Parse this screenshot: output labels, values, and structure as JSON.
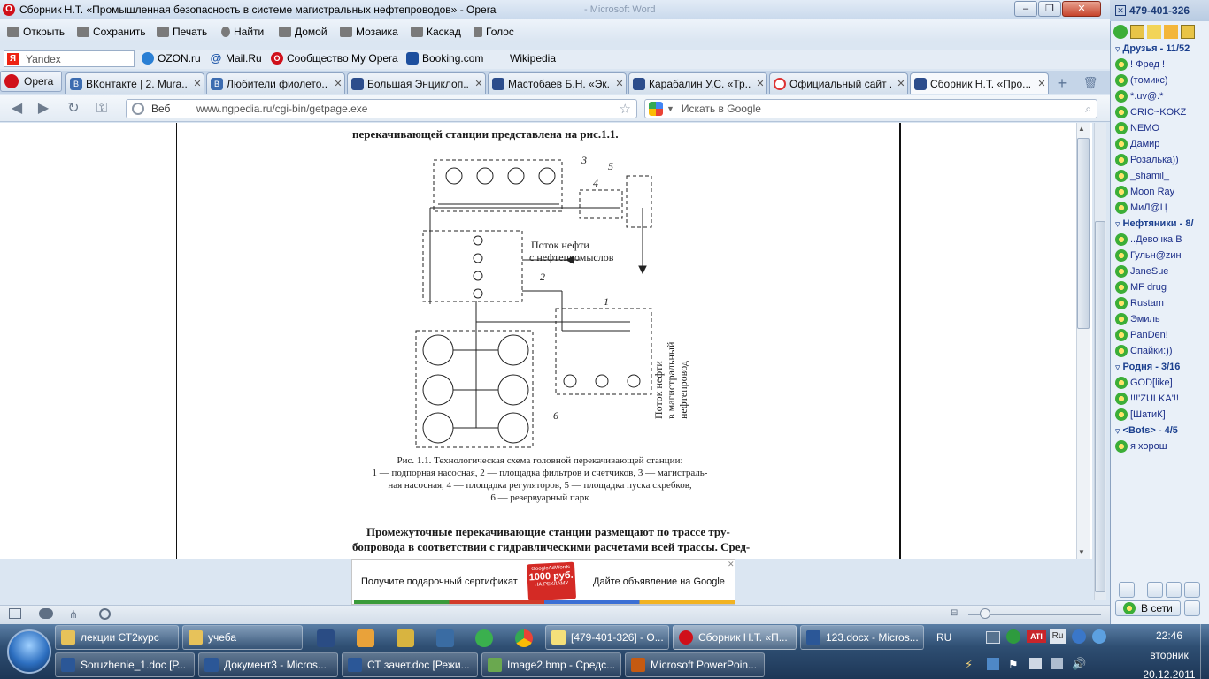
{
  "window": {
    "title": "Сборник Н.Т. «Промышленная безопасность в системе магистральных нефтепроводов» - Opera",
    "ghost_title": "- Microsoft Word"
  },
  "menu": [
    "Открыть",
    "Сохранить",
    "Печать",
    "Найти",
    "Домой",
    "Мозаика",
    "Каскад",
    "Голос"
  ],
  "bookmarks": {
    "yandex": "Yandex",
    "items": [
      "OZON.ru",
      "Mail.Ru",
      "Сообщество My Opera",
      "Booking.com",
      "Wikipedia"
    ]
  },
  "tabs": {
    "opera_button": "Opera",
    "items": [
      {
        "label": "ВКонтакте | 2. Mura...",
        "icon": "vk-icon"
      },
      {
        "label": "Любители фиолето...",
        "icon": "vk-icon"
      },
      {
        "label": "Большая Энциклоп...",
        "icon": "flask-icon"
      },
      {
        "label": "Мастобаев Б.Н. «Эк...",
        "icon": "flask-icon"
      },
      {
        "label": "Карабалин У.С. «Тр...",
        "icon": "flask-icon"
      },
      {
        "label": "Официальный сайт ...",
        "icon": "blocked-icon"
      },
      {
        "label": "Сборник Н.Т. «Про...",
        "icon": "flask-icon"
      }
    ]
  },
  "address": {
    "scope": "Веб",
    "url": "www.ngpedia.ru/cgi-bin/getpage.exe",
    "search_placeholder": "Искать в Google"
  },
  "document": {
    "top_line": "перекачивающей станции представлена на рис.1.1.",
    "diagram_labels": {
      "n1": "1",
      "n2": "2",
      "n3": "3",
      "n4": "4",
      "n5": "5",
      "n6": "6",
      "flow_in_1": "Поток нефти",
      "flow_in_2": "с нефтепромыслов",
      "flow_out_1": "Поток нефти",
      "flow_out_2": "в магистральный",
      "flow_out_3": "нефтепровод"
    },
    "caption": [
      "Рис. 1.1. Технологическая схема головной перекачивающей станции:",
      "1 — подпорная насосная, 2 — площадка фильтров и счетчиков, 3 — магистраль-",
      "ная насосная, 4 — площадка регуляторов, 5 — площадка пуска скребков,",
      "6 — резервуарный парк"
    ],
    "paragraph": [
      "Промежуточные перекачивающие станции размещают по трассе тру-",
      "бопровода в соответствии с гидравлическими расчетами всей трассы. Сред-"
    ]
  },
  "ad": {
    "left_text": "Получите подарочный сертификат",
    "badge_top": "GoogleAdWords",
    "badge_mid": "1000 руб.",
    "badge_bot": "НА РЕКЛАМУ",
    "right_text": "Дайте объявление на Google"
  },
  "qip": {
    "title": "479-401-326",
    "groups": [
      {
        "name": "Друзья - 11/52",
        "row": 0
      },
      {
        "name": "Нефтяники - 8/",
        "row": 11
      },
      {
        "name": "Родня - 3/16",
        "row": 20
      },
      {
        "name": "<Bots> - 4/5",
        "row": 24
      }
    ],
    "contacts": [
      {
        "name": "! Фред !",
        "row": 1
      },
      {
        "name": "(томикс)",
        "row": 2
      },
      {
        "name": "*.uv@.*",
        "row": 3
      },
      {
        "name": "CRIC~KOKZ",
        "row": 4
      },
      {
        "name": "NEMO",
        "row": 5
      },
      {
        "name": "Дамир",
        "row": 6
      },
      {
        "name": "Розалька))",
        "row": 7
      },
      {
        "name": "_shamil_",
        "row": 8
      },
      {
        "name": "Moon Ray",
        "row": 9
      },
      {
        "name": "МиЛ@Ц",
        "row": 10
      },
      {
        "name": "..Девочка В",
        "row": 11.0
      },
      {
        "name": "Гульн@zин",
        "row": 12
      },
      {
        "name": "JaneSue",
        "row": 13
      },
      {
        "name": "MF drug",
        "row": 14
      },
      {
        "name": "Rustam",
        "row": 15
      },
      {
        "name": "Эмиль",
        "row": 16
      },
      {
        "name": "PanDen!",
        "row": 17
      },
      {
        "name": "Спайки:))",
        "row": 18
      },
      {
        "name": "GOD[like]",
        "row": 19
      },
      {
        "name": "!!!'ZULKA'!!",
        "row": 21
      },
      {
        "name": "[ШатиК]",
        "row": 22
      },
      {
        "name": "я хорош",
        "row": 23
      }
    ],
    "status": "В сети"
  },
  "taskbar": {
    "row1": [
      {
        "label": "лекции СТ2курс",
        "color": "#e7c25a"
      },
      {
        "label": "учеба",
        "color": "#e7c25a"
      }
    ],
    "row1b": [
      {
        "label": "[479-401-326] - О...",
        "color": "#f5e07a"
      },
      {
        "label": "Сборник Н.Т. «П...",
        "color": "#d0101a"
      },
      {
        "label": "123.docx - Micros...",
        "color": "#2b5797"
      }
    ],
    "row2": [
      {
        "label": "Soruzhenie_1.doc [Р...",
        "color": "#2b5797"
      },
      {
        "label": "Документ3 - Micros...",
        "color": "#2b5797"
      },
      {
        "label": "СТ зачет.doc [Режи...",
        "color": "#2b5797"
      },
      {
        "label": "Image2.bmp - Средс...",
        "color": "#6aa84f"
      },
      {
        "label": "Microsoft PowerPoin...",
        "color": "#c55a11"
      }
    ],
    "lang": "RU",
    "tray_ru": "Ru",
    "time": "22:46",
    "day": "вторник",
    "date": "20.12.2011"
  }
}
